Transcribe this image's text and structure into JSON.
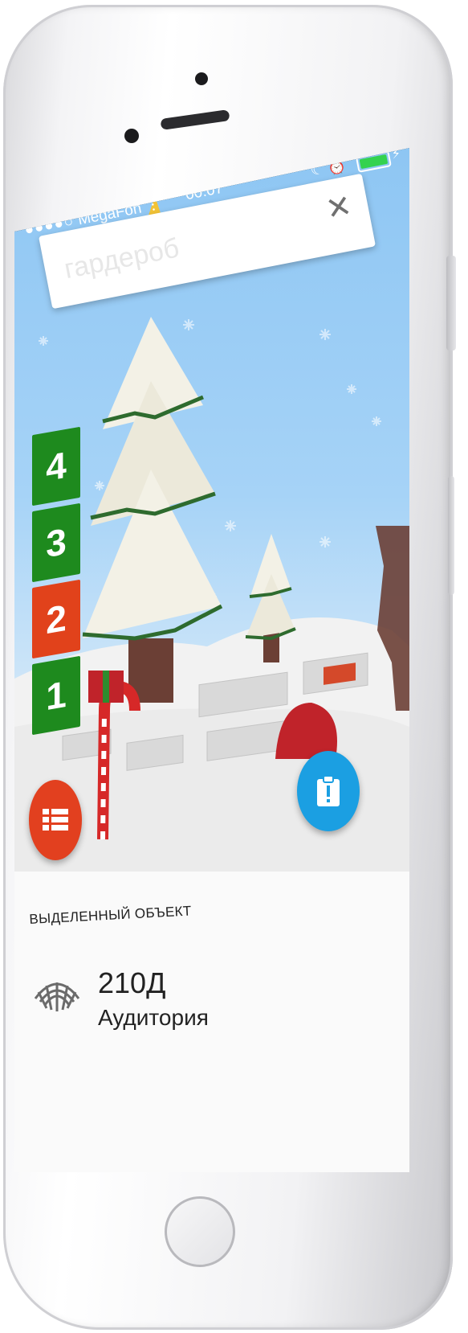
{
  "status_bar": {
    "carrier": "MegaFon",
    "signal_dots": "●●●●○",
    "time": "00:07",
    "battery_level": 0.9,
    "battery_color": "#34d24f"
  },
  "search": {
    "placeholder": "гардероб",
    "clear_icon": "close-icon"
  },
  "floors": [
    {
      "label": "4",
      "color": "#1e8a1e",
      "active": false
    },
    {
      "label": "3",
      "color": "#1e8a1e",
      "active": false
    },
    {
      "label": "2",
      "color": "#e1421b",
      "active": true
    },
    {
      "label": "1",
      "color": "#1e8a1e",
      "active": false
    }
  ],
  "fab_menu": {
    "icon": "list-icon",
    "color": "#e2401f"
  },
  "fab_info": {
    "icon": "clipboard-alert-icon",
    "color": "#1b9fe2"
  },
  "selected": {
    "header": "ВЫДЕЛЕННЫЙ ОБЪЕКТ",
    "code": "210Д",
    "type": "Аудитория",
    "icon": "auditorium-icon"
  }
}
